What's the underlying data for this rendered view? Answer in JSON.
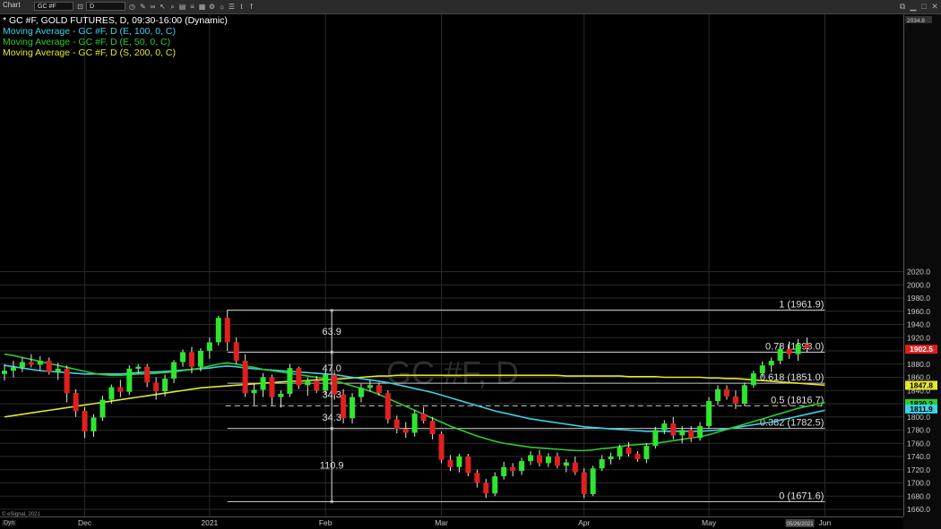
{
  "toolbar": {
    "chart_label": "Chart",
    "symbol_value": "GC #F",
    "interval_value": "D"
  },
  "legend": {
    "line1": "* GC #F, GOLD FUTURES, D, 09:30-16:00 (Dynamic)",
    "line2": "Moving Average - GC #F, D (E, 100, 0, C)",
    "line3": "Moving Average - GC #F, D (E, 50, 0, C)",
    "line4": "Moving Average - GC #F, D (S, 200, 0, C)"
  },
  "footer": {
    "copyright": "© eSignal, 2021",
    "dyn_label": "Dyn"
  },
  "colors": {
    "up": "#2ee62e",
    "down": "#e02020",
    "ma100": "#3cd2e6",
    "ma50": "#2ecc2e",
    "ma200": "#e6e62e",
    "grid": "#2a2a2a",
    "fib": "#c8c8c8",
    "axis_text": "#c8c8c8",
    "last_price_bg": "#e02020"
  },
  "chart_data": {
    "type": "candlestick",
    "watermark": "GC #F, D",
    "y_range": [
      1655,
      2040
    ],
    "y_ticks": [
      1660,
      1680,
      1700,
      1720,
      1740,
      1760,
      1780,
      1800,
      1820,
      1840,
      1860,
      1880,
      1900,
      1920,
      1940,
      1960,
      1980,
      2000,
      2020
    ],
    "y_top_label": "2034.8",
    "x_labels": [
      {
        "label": "Dec",
        "bar": 9
      },
      {
        "label": "2021",
        "bar": 23
      },
      {
        "label": "Feb",
        "bar": 36
      },
      {
        "label": "Mar",
        "bar": 49
      },
      {
        "label": "Apr",
        "bar": 65
      },
      {
        "label": "May",
        "bar": 79
      },
      {
        "label": "Jun",
        "bar": 92
      }
    ],
    "date_marker": "05/26/2021",
    "date_marker_bar": 89,
    "bars": [
      [
        1865,
        1880,
        1855,
        1870
      ],
      [
        1870,
        1885,
        1860,
        1875
      ],
      [
        1875,
        1890,
        1868,
        1883
      ],
      [
        1883,
        1895,
        1875,
        1879
      ],
      [
        1879,
        1892,
        1870,
        1885
      ],
      [
        1885,
        1890,
        1864,
        1868
      ],
      [
        1868,
        1882,
        1856,
        1873
      ],
      [
        1873,
        1878,
        1822,
        1836
      ],
      [
        1836,
        1842,
        1800,
        1809
      ],
      [
        1809,
        1815,
        1768,
        1778
      ],
      [
        1778,
        1804,
        1770,
        1799
      ],
      [
        1799,
        1832,
        1794,
        1826
      ],
      [
        1826,
        1849,
        1820,
        1845
      ],
      [
        1845,
        1856,
        1830,
        1838
      ],
      [
        1838,
        1878,
        1833,
        1873
      ],
      [
        1873,
        1880,
        1866,
        1876
      ],
      [
        1876,
        1880,
        1845,
        1852
      ],
      [
        1852,
        1860,
        1826,
        1839
      ],
      [
        1839,
        1864,
        1831,
        1858
      ],
      [
        1858,
        1886,
        1851,
        1883
      ],
      [
        1883,
        1902,
        1876,
        1898
      ],
      [
        1898,
        1906,
        1866,
        1876
      ],
      [
        1876,
        1904,
        1869,
        1900
      ],
      [
        1900,
        1920,
        1888,
        1913
      ],
      [
        1913,
        1953,
        1908,
        1950
      ],
      [
        1950,
        1962,
        1900,
        1913
      ],
      [
        1913,
        1920,
        1880,
        1885
      ],
      [
        1885,
        1895,
        1830,
        1836
      ],
      [
        1836,
        1850,
        1818,
        1841
      ],
      [
        1841,
        1866,
        1830,
        1860
      ],
      [
        1860,
        1864,
        1818,
        1830
      ],
      [
        1830,
        1840,
        1814,
        1835
      ],
      [
        1835,
        1880,
        1830,
        1874
      ],
      [
        1874,
        1876,
        1842,
        1848
      ],
      [
        1848,
        1860,
        1832,
        1855
      ],
      [
        1855,
        1862,
        1836,
        1840
      ],
      [
        1840,
        1870,
        1835,
        1864
      ],
      [
        1864,
        1868,
        1826,
        1834
      ],
      [
        1834,
        1842,
        1790,
        1798
      ],
      [
        1798,
        1836,
        1790,
        1830
      ],
      [
        1830,
        1850,
        1822,
        1844
      ],
      [
        1844,
        1856,
        1838,
        1848
      ],
      [
        1848,
        1852,
        1832,
        1836
      ],
      [
        1836,
        1840,
        1790,
        1796
      ],
      [
        1796,
        1802,
        1775,
        1782
      ],
      [
        1782,
        1792,
        1768,
        1776
      ],
      [
        1776,
        1810,
        1770,
        1805
      ],
      [
        1805,
        1815,
        1790,
        1794
      ],
      [
        1794,
        1800,
        1766,
        1774
      ],
      [
        1774,
        1778,
        1730,
        1735
      ],
      [
        1735,
        1742,
        1718,
        1724
      ],
      [
        1724,
        1744,
        1716,
        1740
      ],
      [
        1740,
        1744,
        1710,
        1715
      ],
      [
        1715,
        1720,
        1693,
        1700
      ],
      [
        1700,
        1706,
        1677,
        1684
      ],
      [
        1684,
        1716,
        1680,
        1710
      ],
      [
        1710,
        1732,
        1705,
        1724
      ],
      [
        1724,
        1730,
        1710,
        1718
      ],
      [
        1718,
        1738,
        1712,
        1733
      ],
      [
        1733,
        1748,
        1727,
        1742
      ],
      [
        1742,
        1750,
        1725,
        1730
      ],
      [
        1730,
        1745,
        1724,
        1740
      ],
      [
        1740,
        1746,
        1722,
        1726
      ],
      [
        1726,
        1736,
        1716,
        1731
      ],
      [
        1731,
        1740,
        1712,
        1716
      ],
      [
        1716,
        1722,
        1677,
        1683
      ],
      [
        1683,
        1726,
        1680,
        1722
      ],
      [
        1722,
        1742,
        1718,
        1736
      ],
      [
        1736,
        1746,
        1728,
        1740
      ],
      [
        1740,
        1758,
        1735,
        1754
      ],
      [
        1754,
        1762,
        1740,
        1744
      ],
      [
        1744,
        1748,
        1732,
        1736
      ],
      [
        1736,
        1760,
        1730,
        1756
      ],
      [
        1756,
        1785,
        1752,
        1780
      ],
      [
        1780,
        1795,
        1774,
        1790
      ],
      [
        1790,
        1800,
        1766,
        1772
      ],
      [
        1772,
        1786,
        1760,
        1780
      ],
      [
        1780,
        1786,
        1762,
        1768
      ],
      [
        1768,
        1792,
        1764,
        1786
      ],
      [
        1786,
        1830,
        1782,
        1824
      ],
      [
        1824,
        1848,
        1818,
        1842
      ],
      [
        1842,
        1848,
        1826,
        1831
      ],
      [
        1831,
        1840,
        1812,
        1820
      ],
      [
        1820,
        1852,
        1816,
        1848
      ],
      [
        1848,
        1870,
        1844,
        1866
      ],
      [
        1866,
        1884,
        1860,
        1878
      ],
      [
        1878,
        1890,
        1868,
        1885
      ],
      [
        1885,
        1908,
        1880,
        1903
      ],
      [
        1903,
        1914,
        1888,
        1895
      ],
      [
        1895,
        1918,
        1885,
        1910
      ],
      [
        1910,
        1920,
        1898,
        1904
      ]
    ],
    "ma100": [
      1878,
      1876,
      1874,
      1872,
      1870,
      1869,
      1868,
      1867,
      1866,
      1865,
      1865,
      1865,
      1865,
      1865,
      1866,
      1867,
      1868,
      1868,
      1869,
      1870,
      1871,
      1872,
      1873,
      1874,
      1876,
      1877,
      1876,
      1874,
      1873,
      1872,
      1871,
      1870,
      1869,
      1868,
      1867,
      1866,
      1865,
      1864,
      1862,
      1860,
      1858,
      1856,
      1854,
      1852,
      1849,
      1846,
      1843,
      1840,
      1837,
      1833,
      1829,
      1825,
      1821,
      1817,
      1813,
      1809,
      1806,
      1803,
      1800,
      1797,
      1795,
      1793,
      1791,
      1789,
      1787,
      1785,
      1784,
      1783,
      1782,
      1781,
      1780,
      1779,
      1778,
      1778,
      1778,
      1778,
      1778,
      1778,
      1778,
      1779,
      1780,
      1782,
      1784,
      1786,
      1788,
      1790,
      1792,
      1795,
      1798,
      1801,
      1804,
      1807,
      1810
    ],
    "ma50": [
      1895,
      1893,
      1890,
      1887,
      1884,
      1881,
      1878,
      1875,
      1872,
      1869,
      1866,
      1864,
      1863,
      1863,
      1864,
      1865,
      1865,
      1866,
      1867,
      1868,
      1870,
      1872,
      1874,
      1877,
      1880,
      1882,
      1880,
      1877,
      1875,
      1872,
      1870,
      1868,
      1866,
      1864,
      1862,
      1860,
      1858,
      1855,
      1851,
      1847,
      1843,
      1839,
      1834,
      1828,
      1822,
      1816,
      1810,
      1804,
      1798,
      1792,
      1786,
      1781,
      1776,
      1771,
      1767,
      1763,
      1760,
      1758,
      1756,
      1754,
      1753,
      1752,
      1751,
      1750,
      1749,
      1749,
      1750,
      1752,
      1753,
      1755,
      1757,
      1758,
      1759,
      1760,
      1762,
      1764,
      1766,
      1768,
      1770,
      1773,
      1777,
      1781,
      1785,
      1789,
      1793,
      1797,
      1801,
      1805,
      1809,
      1813,
      1816,
      1819,
      1822
    ],
    "ma200": [
      1800,
      1802,
      1804,
      1806,
      1808,
      1810,
      1812,
      1814,
      1816,
      1818,
      1820,
      1822,
      1824,
      1826,
      1828,
      1830,
      1832,
      1834,
      1836,
      1838,
      1840,
      1842,
      1844,
      1845,
      1846,
      1847,
      1848,
      1849,
      1850,
      1851,
      1852,
      1853,
      1854,
      1854,
      1855,
      1856,
      1856,
      1857,
      1858,
      1859,
      1860,
      1861,
      1862,
      1862,
      1863,
      1863,
      1863,
      1863,
      1863,
      1863,
      1863,
      1863,
      1863,
      1863,
      1863,
      1863,
      1863,
      1863,
      1863,
      1863,
      1863,
      1863,
      1863,
      1862,
      1862,
      1862,
      1862,
      1862,
      1862,
      1862,
      1861,
      1861,
      1861,
      1861,
      1860,
      1860,
      1860,
      1860,
      1860,
      1859,
      1859,
      1858,
      1858,
      1857,
      1856,
      1855,
      1854,
      1853,
      1852,
      1851,
      1850,
      1849,
      1848
    ],
    "fibonacci": {
      "start_bar": 25,
      "end_bar": 92,
      "levels": [
        {
          "label": "1 (1961.9)",
          "value": 1961.9
        },
        {
          "label": "0.78 (1898.0)",
          "value": 1898.0
        },
        {
          "label": "0.618 (1851.0)",
          "value": 1851.0
        },
        {
          "label": "0.5 (1816.7)",
          "value": 1816.7,
          "dashed": true
        },
        {
          "label": "0.382 (1782.5)",
          "value": 1782.5
        },
        {
          "label": "0 (1671.6)",
          "value": 1671.6
        }
      ],
      "segments": [
        {
          "label": "63.9",
          "value": 1930
        },
        {
          "label": "47.0",
          "value": 1874
        },
        {
          "label": "34.3",
          "value": 1834
        },
        {
          "label": "34.3",
          "value": 1800
        },
        {
          "label": "110.9",
          "value": 1727
        }
      ]
    },
    "price_tags": [
      {
        "label": "1902.5",
        "value": 1902.5,
        "color": "#e02020",
        "text": "#fff"
      },
      {
        "label": "1847.8",
        "value": 1847.8,
        "color": "#e6e62e",
        "text": "#000"
      },
      {
        "label": "1820.2",
        "value": 1820.2,
        "color": "#2ecc2e",
        "text": "#000"
      },
      {
        "label": "1811.9",
        "value": 1811.9,
        "color": "#3cd2e6",
        "text": "#000"
      }
    ]
  }
}
